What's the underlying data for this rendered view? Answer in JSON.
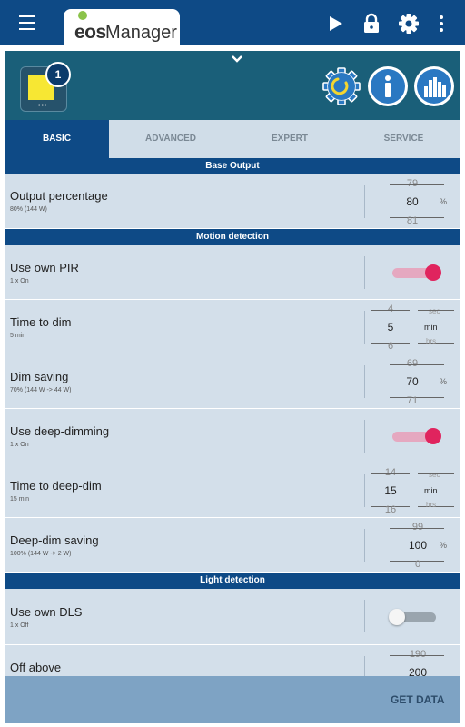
{
  "app": {
    "logo_eos": "eos",
    "logo_manager": "Manager"
  },
  "toolbar": {
    "icons": [
      "menu-icon",
      "play-icon",
      "lock-icon",
      "gear-icon",
      "more-vert-icon"
    ]
  },
  "device": {
    "badge": "1",
    "dots": "•••"
  },
  "tabs": [
    {
      "label": "BASIC",
      "active": true
    },
    {
      "label": "ADVANCED",
      "active": false
    },
    {
      "label": "EXPERT",
      "active": false
    },
    {
      "label": "SERVICE",
      "active": false
    }
  ],
  "sections": {
    "base_output": "Base Output",
    "motion_detection": "Motion detection",
    "light_detection": "Light detection"
  },
  "rows": {
    "output_percentage": {
      "title": "Output percentage",
      "sub": "80% (144 W)",
      "prev": "79",
      "value": "80",
      "next": "81",
      "unit": "%"
    },
    "use_own_pir": {
      "title": "Use own PIR",
      "sub": "1 x On",
      "on": true
    },
    "time_to_dim": {
      "title": "Time to dim",
      "sub": "5 min",
      "prev": "4",
      "value": "5",
      "next": "6",
      "unit_prev": "sec",
      "unit": "min",
      "unit_next": "hrs"
    },
    "dim_saving": {
      "title": "Dim saving",
      "sub": "70% (144 W -> 44 W)",
      "prev": "69",
      "value": "70",
      "next": "71",
      "unit": "%"
    },
    "use_deep_dimming": {
      "title": "Use deep-dimming",
      "sub": "1 x On",
      "on": true
    },
    "time_to_deep_dim": {
      "title": "Time to deep-dim",
      "sub": "15 min",
      "prev": "14",
      "value": "15",
      "next": "16",
      "unit_prev": "sec",
      "unit": "min",
      "unit_next": "hrs"
    },
    "deep_dim_saving": {
      "title": "Deep-dim saving",
      "sub": "100% (144 W -> 2 W)",
      "prev": "99",
      "value": "100",
      "next": "0",
      "unit": "%"
    },
    "use_own_dls": {
      "title": "Use own DLS",
      "sub": "1 x Off",
      "on": false
    },
    "off_above": {
      "title": "Off above",
      "prev": "190",
      "value": "200"
    }
  },
  "footer": {
    "get_data": "GET DATA"
  },
  "colors": {
    "primary": "#0e4a86",
    "header": "#1a5f79",
    "toggle_on": "#e0245e",
    "row_bg": "#d3dfea",
    "bottom_bar": "#7ea3c4"
  }
}
